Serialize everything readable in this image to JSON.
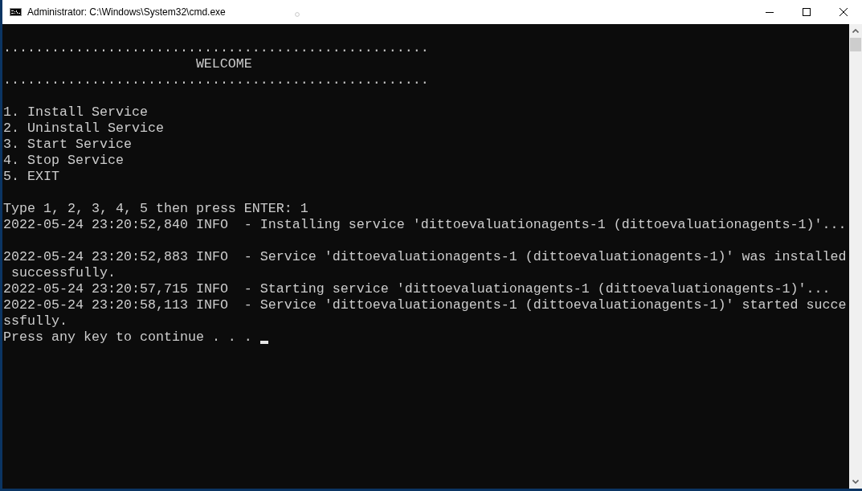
{
  "window": {
    "title": "Administrator: C:\\Windows\\System32\\cmd.exe"
  },
  "console": {
    "cursor": true,
    "lines": [
      {
        "kind": "blank"
      },
      {
        "kind": "rule",
        "text": "....................................................."
      },
      {
        "kind": "heading",
        "text": "WELCOME"
      },
      {
        "kind": "rule",
        "text": "....................................................."
      },
      {
        "kind": "blank"
      },
      {
        "kind": "option",
        "text": "1. Install Service"
      },
      {
        "kind": "option",
        "text": "2. Uninstall Service"
      },
      {
        "kind": "option",
        "text": "3. Start Service"
      },
      {
        "kind": "option",
        "text": "4. Stop Service"
      },
      {
        "kind": "option",
        "text": "5. EXIT"
      },
      {
        "kind": "blank"
      },
      {
        "kind": "prompt",
        "text": "Type 1, 2, 3, 4, 5 then press ENTER: 1"
      },
      {
        "kind": "log",
        "text": "2022-05-24 23:20:52,840 INFO  - Installing service 'dittoevaluationagents-1 (dittoevaluationagents-1)'..."
      },
      {
        "kind": "blank"
      },
      {
        "kind": "log",
        "text": "2022-05-24 23:20:52,883 INFO  - Service 'dittoevaluationagents-1 (dittoevaluationagents-1)' was installed successfully."
      },
      {
        "kind": "log",
        "text": "2022-05-24 23:20:57,715 INFO  - Starting service 'dittoevaluationagents-1 (dittoevaluationagents-1)'..."
      },
      {
        "kind": "log",
        "text": "2022-05-24 23:20:58,113 INFO  - Service 'dittoevaluationagents-1 (dittoevaluationagents-1)' started successfully."
      },
      {
        "kind": "message",
        "text": "Press any key to continue . . ."
      }
    ]
  }
}
